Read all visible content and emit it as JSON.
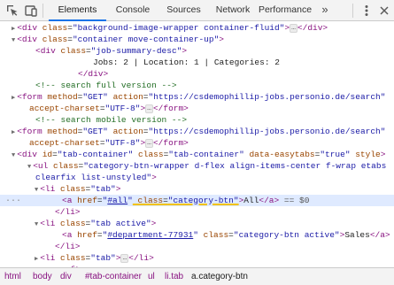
{
  "toolbar": {
    "tabs": [
      {
        "label": "Elements"
      },
      {
        "label": "Console"
      },
      {
        "label": "Sources"
      },
      {
        "label": "Network"
      },
      {
        "label": "Performance"
      }
    ],
    "more_label": "»",
    "icons": [
      "inspect-icon",
      "device-toolbar-icon",
      "kebab-menu-icon",
      "close-icon"
    ]
  },
  "tree": {
    "lines": [
      {
        "tokens": [
          {
            "c": "tg",
            "t": "▶"
          },
          {
            "c": "tg",
            "t": "<div"
          },
          {
            "c": "an",
            "t": " class"
          },
          {
            "c": "tx",
            "t": "="
          },
          {
            "c": "av",
            "t": "\"background-image-wrapper container-fluid\""
          },
          {
            "c": "tg",
            "t": ">"
          },
          {
            "c": "ell",
            "t": "…"
          },
          {
            "c": "tg",
            "t": "</div>"
          }
        ]
      },
      {
        "tokens": [
          {
            "c": "tg",
            "t": "▼"
          },
          {
            "c": "tg",
            "t": "<div"
          },
          {
            "c": "an",
            "t": " class"
          },
          {
            "c": "tx",
            "t": "="
          },
          {
            "c": "av",
            "t": "\"container move-container-up\""
          },
          {
            "c": "tg",
            "t": ">"
          }
        ]
      },
      {
        "tokens": [
          {
            "c": "tg",
            "t": "<div"
          },
          {
            "c": "an",
            "t": " class"
          },
          {
            "c": "tx",
            "t": "="
          },
          {
            "c": "av",
            "t": "\"job-summary-desc\""
          },
          {
            "c": "tg",
            "t": ">"
          }
        ]
      },
      {
        "tokens": [
          {
            "c": "tx",
            "t": "Jobs: 2 | Location: 1 | Categories: 2"
          }
        ]
      },
      {
        "tokens": [
          {
            "c": "tg",
            "t": "</div>"
          }
        ]
      },
      {
        "tokens": [
          {
            "c": "cm",
            "t": "<!-- search full version -->"
          }
        ]
      },
      {
        "tokens": [
          {
            "c": "tg",
            "t": "▶"
          },
          {
            "c": "tg",
            "t": "<form"
          },
          {
            "c": "an",
            "t": " method"
          },
          {
            "c": "tx",
            "t": "="
          },
          {
            "c": "av",
            "t": "\"GET\""
          },
          {
            "c": "an",
            "t": " action"
          },
          {
            "c": "tx",
            "t": "="
          },
          {
            "c": "av",
            "t": "\"https://csdemophillip-jobs.personio.de/search\""
          }
        ]
      },
      {
        "tokens": [
          {
            "c": "an",
            "t": "accept-charset"
          },
          {
            "c": "tx",
            "t": "="
          },
          {
            "c": "av",
            "t": "\"UTF-8\""
          },
          {
            "c": "tg",
            "t": ">"
          },
          {
            "c": "ell",
            "t": "…"
          },
          {
            "c": "tg",
            "t": "</form>"
          }
        ]
      },
      {
        "tokens": [
          {
            "c": "cm",
            "t": "<!-- search mobile version -->"
          }
        ]
      },
      {
        "tokens": [
          {
            "c": "tg",
            "t": "▶"
          },
          {
            "c": "tg",
            "t": "<form"
          },
          {
            "c": "an",
            "t": " method"
          },
          {
            "c": "tx",
            "t": "="
          },
          {
            "c": "av",
            "t": "\"GET\""
          },
          {
            "c": "an",
            "t": " action"
          },
          {
            "c": "tx",
            "t": "="
          },
          {
            "c": "av",
            "t": "\"https://csdemophillip-jobs.personio.de/search\""
          }
        ]
      },
      {
        "tokens": [
          {
            "c": "an",
            "t": "accept-charset"
          },
          {
            "c": "tx",
            "t": "="
          },
          {
            "c": "av",
            "t": "\"UTF-8\""
          },
          {
            "c": "tg",
            "t": ">"
          },
          {
            "c": "ell",
            "t": "…"
          },
          {
            "c": "tg",
            "t": "</form>"
          }
        ]
      },
      {
        "tokens": [
          {
            "c": "tg",
            "t": "▼"
          },
          {
            "c": "tg",
            "t": "<div"
          },
          {
            "c": "an",
            "t": " id"
          },
          {
            "c": "tx",
            "t": "="
          },
          {
            "c": "av",
            "t": "\"tab-container\""
          },
          {
            "c": "an",
            "t": " class"
          },
          {
            "c": "tx",
            "t": "="
          },
          {
            "c": "av",
            "t": "\"tab-container\""
          },
          {
            "c": "an",
            "t": " data-easytabs"
          },
          {
            "c": "tx",
            "t": "="
          },
          {
            "c": "av",
            "t": "\"true\""
          },
          {
            "c": "an",
            "t": " style"
          },
          {
            "c": "tg",
            "t": ">"
          }
        ]
      },
      {
        "tokens": [
          {
            "c": "tg",
            "t": "▼"
          },
          {
            "c": "tg",
            "t": "<ul"
          },
          {
            "c": "an",
            "t": " class"
          },
          {
            "c": "tx",
            "t": "="
          },
          {
            "c": "av",
            "t": "\"category-btn-wrapper d-flex align-items-center f-wrap etabs"
          }
        ]
      },
      {
        "tokens": [
          {
            "c": "av",
            "t": "clearfix list-unstyled\""
          },
          {
            "c": "tg",
            "t": ">"
          }
        ]
      },
      {
        "tokens": [
          {
            "c": "tg",
            "t": "▼"
          },
          {
            "c": "tg",
            "t": "<li"
          },
          {
            "c": "an",
            "t": " class"
          },
          {
            "c": "tx",
            "t": "="
          },
          {
            "c": "av",
            "t": "\"tab\""
          },
          {
            "c": "tg",
            "t": ">"
          }
        ]
      },
      {
        "tokens": [
          {
            "c": "tg",
            "t": "<a"
          },
          {
            "c": "an",
            "t": " href"
          },
          {
            "c": "tx",
            "t": "="
          },
          {
            "c": "av",
            "t": "\""
          },
          {
            "c": "lk",
            "t": "#all"
          },
          {
            "c": "av",
            "t": "\""
          },
          {
            "c": "an hl",
            "t": " class"
          },
          {
            "c": "tx hl",
            "t": "="
          },
          {
            "c": "av hl",
            "t": "\"category-btn\""
          },
          {
            "c": "tg",
            "t": ">"
          },
          {
            "c": "tx",
            "t": "All"
          },
          {
            "c": "tg",
            "t": "</a>"
          },
          {
            "c": "dg",
            "t": " == $0"
          }
        ]
      },
      {
        "tokens": [
          {
            "c": "tg",
            "t": "</li>"
          }
        ]
      },
      {
        "tokens": [
          {
            "c": "tg",
            "t": "▼"
          },
          {
            "c": "tg",
            "t": "<li"
          },
          {
            "c": "an",
            "t": " class"
          },
          {
            "c": "tx",
            "t": "="
          },
          {
            "c": "av",
            "t": "\"tab active\""
          },
          {
            "c": "tg",
            "t": ">"
          }
        ]
      },
      {
        "tokens": [
          {
            "c": "tg",
            "t": "<a"
          },
          {
            "c": "an",
            "t": " href"
          },
          {
            "c": "tx",
            "t": "="
          },
          {
            "c": "av",
            "t": "\""
          },
          {
            "c": "lk",
            "t": "#department-77931"
          },
          {
            "c": "av",
            "t": "\""
          },
          {
            "c": "an",
            "t": " class"
          },
          {
            "c": "tx",
            "t": "="
          },
          {
            "c": "av",
            "t": "\"category-btn active\""
          },
          {
            "c": "tg",
            "t": ">"
          },
          {
            "c": "tx",
            "t": "Sales"
          },
          {
            "c": "tg",
            "t": "</a>"
          }
        ]
      },
      {
        "tokens": [
          {
            "c": "tg",
            "t": "</li>"
          }
        ]
      },
      {
        "tokens": [
          {
            "c": "tg",
            "t": "▶"
          },
          {
            "c": "tg",
            "t": "<li"
          },
          {
            "c": "an",
            "t": " class"
          },
          {
            "c": "tx",
            "t": "="
          },
          {
            "c": "av",
            "t": "\"tab\""
          },
          {
            "c": "tg",
            "t": ">"
          },
          {
            "c": "ell",
            "t": "…"
          },
          {
            "c": "tg",
            "t": "</li>"
          }
        ]
      },
      {
        "tokens": [
          {
            "c": "tg",
            "t": "::after"
          }
        ]
      }
    ],
    "selected_marker": "..."
  },
  "breadcrumbs": [
    {
      "label": "html"
    },
    {
      "label": "body"
    },
    {
      "label": "div"
    },
    {
      "label": "#tab-container"
    },
    {
      "label": "ul"
    },
    {
      "label": "li.tab"
    },
    {
      "label": "a.category-btn"
    }
  ]
}
